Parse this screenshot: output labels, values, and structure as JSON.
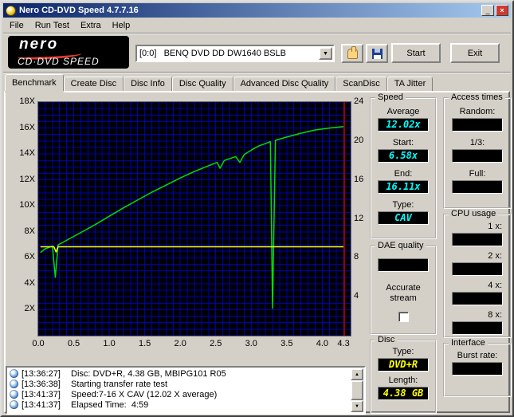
{
  "window": {
    "title": "Nero CD-DVD Speed 4.7.7.16"
  },
  "icons": {
    "minimize": "_",
    "close": "×",
    "dropdown_arrow": "▼",
    "scroll_up": "▲",
    "scroll_down": "▼"
  },
  "menu": {
    "items": [
      "File",
      "Run Test",
      "Extra",
      "Help"
    ]
  },
  "toolbar": {
    "logo_line1": "nero",
    "logo_line2": "CD·DVD SPEED",
    "drive_selected": "[0:0]   BENQ DVD DD DW1640 BSLB",
    "start_label": "Start",
    "exit_label": "Exit"
  },
  "tabs": [
    "Benchmark",
    "Create Disc",
    "Disc Info",
    "Disc Quality",
    "Advanced Disc Quality",
    "ScanDisc",
    "TA Jitter"
  ],
  "active_tab_index": 0,
  "chart_data": {
    "type": "line",
    "x_axis": {
      "min": 0,
      "max": 4.4,
      "ticks": [
        "0.0",
        "0.5",
        "1.0",
        "1.5",
        "2.0",
        "2.5",
        "3.0",
        "3.5",
        "4.0",
        "4.3"
      ]
    },
    "y_axis_left": {
      "min": 0,
      "max": 18,
      "ticks": [
        "18X",
        "16X",
        "14X",
        "12X",
        "10X",
        "8X",
        "6X",
        "4X",
        "2X"
      ]
    },
    "y_axis_right": {
      "min": 0,
      "max": 24,
      "ticks": [
        "24",
        "20",
        "16",
        "12",
        "8",
        "4"
      ]
    },
    "grid": {
      "x_step": 0.1,
      "y_step": 0.5,
      "color": "#0000cc",
      "bg": "#000000"
    },
    "series": [
      {
        "name": "transfer-rate",
        "color": "#00e000",
        "points": [
          [
            0.03,
            6.4
          ],
          [
            0.1,
            6.7
          ],
          [
            0.2,
            6.9
          ],
          [
            0.24,
            4.5
          ],
          [
            0.28,
            7.0
          ],
          [
            0.4,
            7.35
          ],
          [
            0.6,
            7.95
          ],
          [
            0.8,
            8.55
          ],
          [
            1.0,
            9.2
          ],
          [
            1.2,
            9.85
          ],
          [
            1.4,
            10.45
          ],
          [
            1.6,
            11.05
          ],
          [
            1.8,
            11.6
          ],
          [
            2.0,
            12.15
          ],
          [
            2.2,
            12.65
          ],
          [
            2.4,
            13.1
          ],
          [
            2.52,
            13.35
          ],
          [
            2.56,
            12.9
          ],
          [
            2.62,
            13.5
          ],
          [
            2.78,
            13.8
          ],
          [
            2.84,
            13.35
          ],
          [
            2.9,
            13.95
          ],
          [
            3.0,
            14.3
          ],
          [
            3.1,
            14.6
          ],
          [
            3.2,
            14.8
          ],
          [
            3.27,
            14.95
          ],
          [
            3.3,
            2.1
          ],
          [
            3.34,
            15.05
          ],
          [
            3.5,
            15.3
          ],
          [
            3.7,
            15.6
          ],
          [
            3.9,
            15.85
          ],
          [
            4.1,
            16.0
          ],
          [
            4.3,
            16.11
          ]
        ]
      },
      {
        "name": "rotation-speed",
        "color": "#ffff00",
        "points": [
          [
            0.03,
            6.85
          ],
          [
            0.22,
            6.85
          ],
          [
            0.25,
            6.45
          ],
          [
            0.28,
            6.85
          ],
          [
            4.3,
            6.85
          ]
        ]
      }
    ],
    "end_marker": {
      "x": 4.31,
      "color": "#990000"
    }
  },
  "panels": {
    "speed": {
      "title": "Speed",
      "average_label": "Average",
      "average": "12.02x",
      "start_label": "Start:",
      "start": "6.58x",
      "end_label": "End:",
      "end": "16.11x",
      "type_label": "Type:",
      "type": "CAV",
      "value_color": "#00ffff"
    },
    "dae": {
      "title": "DAE quality",
      "accurate_label": "Accurate stream"
    },
    "disc": {
      "title": "Disc",
      "type_label": "Type:",
      "type": "DVD+R",
      "length_label": "Length:",
      "length": "4.38 GB",
      "value_color": "#ffff00"
    },
    "access": {
      "title": "Access times",
      "random_label": "Random:",
      "third_label": "1/3:",
      "full_label": "Full:"
    },
    "cpu": {
      "title": "CPU usage",
      "labels": [
        "1 x:",
        "2 x:",
        "4 x:",
        "8 x:"
      ]
    },
    "interface": {
      "title": "Interface",
      "burst_label": "Burst rate:"
    }
  },
  "log": {
    "lines": [
      {
        "time": "[13:36:27]",
        "text": "Disc: DVD+R, 4.38 GB, MBIPG101 R05"
      },
      {
        "time": "[13:36:38]",
        "text": "Starting transfer rate test"
      },
      {
        "time": "[13:41:37]",
        "text": "Speed:7-16 X CAV (12.02 X average)"
      },
      {
        "time": "[13:41:37]",
        "text": "Elapsed Time:  4:59"
      }
    ]
  }
}
